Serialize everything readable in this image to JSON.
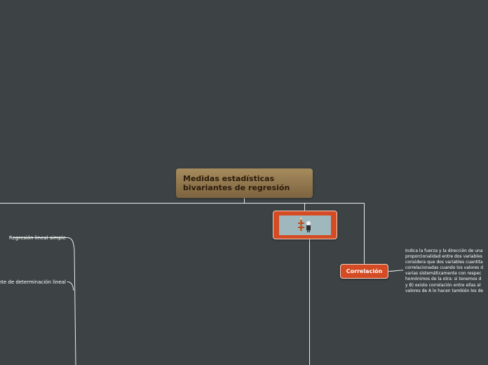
{
  "map": {
    "central_topic": "Medidas estadísticas bivariantes de regresión",
    "image_node": {
      "icon": "image-icon"
    },
    "correlacion": {
      "label": "Correlación",
      "description_lines": [
        "Indica la fuerza y la dirección de una",
        "proporcionalidad entre dos variables",
        "considera que dos variables cuantita",
        "correlacionadas cuando los valores d",
        "varias sistemáticamente con respec",
        "homónimos de la otra: si tenemos d",
        "y B) existe correlación entre ellas al",
        "valores de A lo hacen también los de"
      ]
    },
    "left_topics": [
      "Regresión lineal simple",
      "iente de determinación lineal"
    ]
  },
  "colors": {
    "background": "#3d4344",
    "central_fill": "#8f7550",
    "central_text": "#2c1c0c",
    "subtopic_fill": "#d44b24",
    "line": "#e8ecec"
  }
}
